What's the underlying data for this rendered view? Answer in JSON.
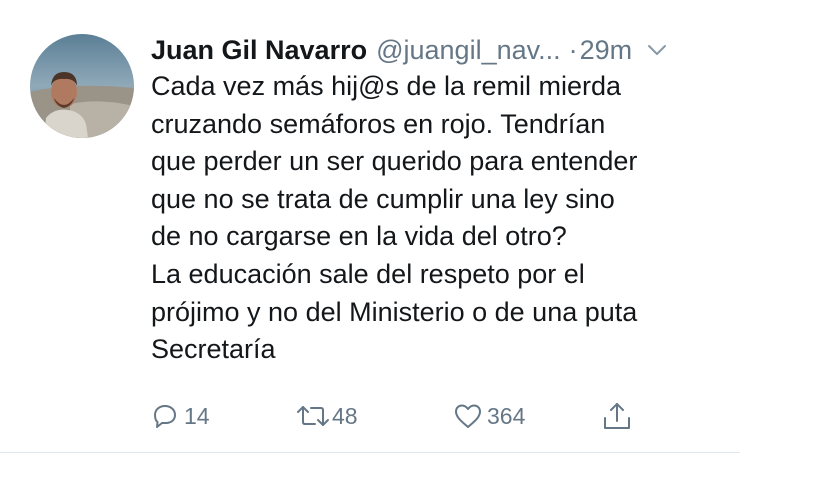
{
  "tweet": {
    "author": {
      "display_name": "Juan Gil Navarro",
      "handle": "@juangil_nav...",
      "avatar_icon": "profile-photo"
    },
    "separator": "·",
    "time": "29m",
    "body_lines": [
      "Cada vez más hij@s de la remil mierda",
      "cruzando semáforos en rojo. Tendrían",
      "que perder un ser querido para entender",
      "que no se trata de cumplir una ley sino",
      "de no cargarse en la vida del otro?",
      "La educación sale del respeto por el",
      "prójimo y no del Ministerio o de una puta",
      "Secretaría"
    ],
    "actions": {
      "reply": {
        "icon": "reply-icon",
        "count": "14"
      },
      "retweet": {
        "icon": "retweet-icon",
        "count": "48"
      },
      "like": {
        "icon": "heart-icon",
        "count": "364"
      },
      "share": {
        "icon": "share-icon"
      }
    }
  },
  "colors": {
    "text": "#14171a",
    "secondary": "#657786",
    "divider": "#e1e8ed"
  }
}
